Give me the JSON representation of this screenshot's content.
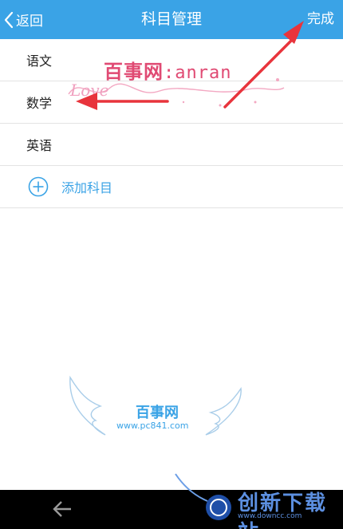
{
  "header": {
    "back_label": "返回",
    "title": "科目管理",
    "done_label": "完成"
  },
  "subjects": [
    {
      "label": "语文"
    },
    {
      "label": "数学"
    },
    {
      "label": "英语"
    }
  ],
  "add_subject_label": "添加科目",
  "watermarks": {
    "top_cn": "百事网",
    "top_en": ":anran",
    "top_script": "Love",
    "center_cn": "百事网",
    "center_url": "www.pc841.com",
    "brand_cn": "创新下载站",
    "brand_url": "www.downcc.com"
  },
  "colors": {
    "accent": "#3aa3e6",
    "arrow": "#e8343c"
  }
}
